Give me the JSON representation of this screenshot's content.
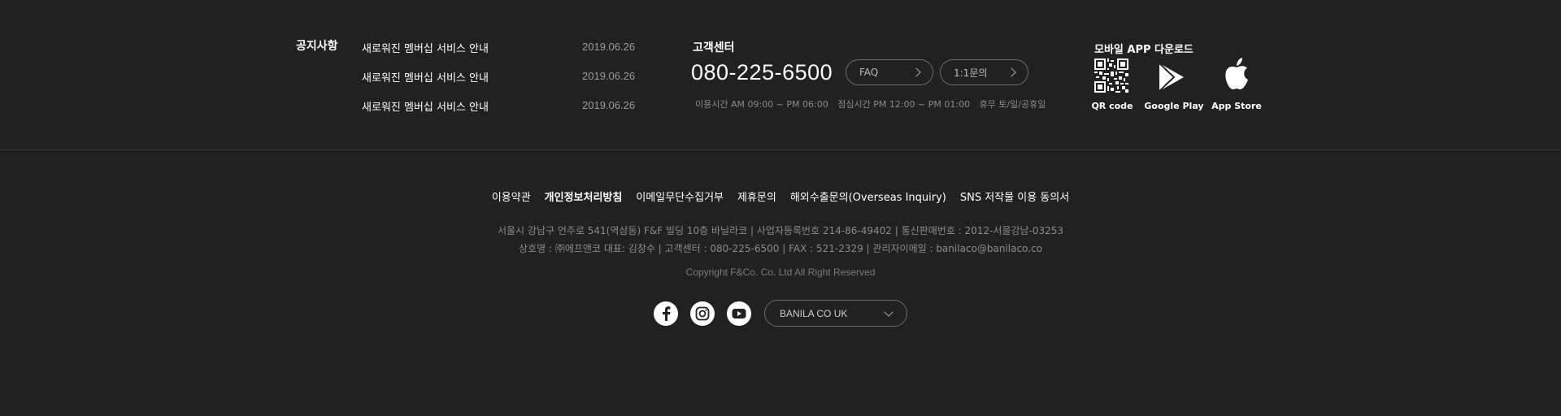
{
  "notice": {
    "title": "공지사항",
    "items": [
      {
        "text": "새로워진 멤버십 서비스 안내",
        "date": "2019.06.26"
      },
      {
        "text": "새로워진 멤버십 서비스 안내",
        "date": "2019.06.26"
      },
      {
        "text": "새로워진 멤버십 서비스 안내",
        "date": "2019.06.26"
      }
    ]
  },
  "customer_center": {
    "title": "고객센터",
    "phone": "080-225-6500",
    "faq_label": "FAQ",
    "inquiry_label": "1:1문의",
    "hours": "이용시간 AM 09:00 ~ PM 06:00",
    "lunch": "점심시간 PM 12:00 ~ PM 01:00",
    "holiday": "휴무 토/일/공휴일"
  },
  "app": {
    "title": "모바일 APP 다운로드",
    "qr_label": "QR code",
    "google_label": "Google Play",
    "apple_label": "App Store"
  },
  "footer_links": {
    "terms": "이용약관",
    "privacy": "개인정보처리방침",
    "email_refusal": "이메일무단수집거부",
    "partnership": "제휴문의",
    "overseas": "해외수출문의(Overseas Inquiry)",
    "sns_consent": "SNS 저작물 이용 동의서"
  },
  "company_info": {
    "line1": "서울시 강남구 언주로 541(역삼동) F&F 빌딩 10층 바닐라코  |  사업자등록번호 214-86-49402  |  통신판매번호 : 2012-서울강남-03253",
    "line2": "상호명 : ㈜에프앤코  대표: 김창수  |  고객센터 : 080-225-6500  |  FAX : 521-2329  |  관리자이메일 : banilaco@banilaco.co"
  },
  "copyright": "Copyright F&Co. Co. Ltd All Right Reserved",
  "language_select": {
    "selected": "BANILA CO UK"
  },
  "social": {
    "icons": [
      "facebook-icon",
      "instagram-icon",
      "youtube-icon"
    ]
  },
  "colors": {
    "background": "#212121",
    "text": "#ffffff",
    "muted": "#8a8a8a",
    "border": "#6a6a6a"
  }
}
